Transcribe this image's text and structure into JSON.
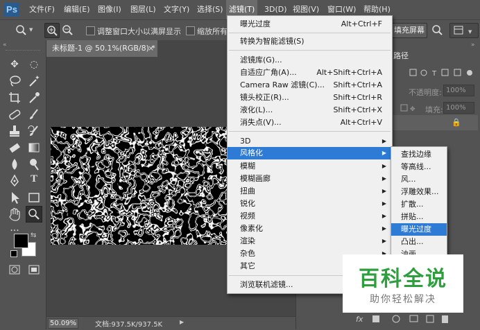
{
  "app": {
    "logo": "Ps"
  },
  "menubar": [
    {
      "label": "文件(F)"
    },
    {
      "label": "编辑(E)"
    },
    {
      "label": "图像(I)"
    },
    {
      "label": "图层(L)"
    },
    {
      "label": "文字(Y)"
    },
    {
      "label": "选择(S)"
    },
    {
      "label": "滤镜(T)"
    },
    {
      "label": "3D(D)"
    },
    {
      "label": "视图(V)"
    },
    {
      "label": "窗口(W)"
    },
    {
      "label": "帮助(H)"
    }
  ],
  "options": {
    "resize_windows": "调整窗口大小以满屏显示",
    "zoom_all": "缩放所有",
    "fill_screen": "填充屏幕"
  },
  "document": {
    "tab_title": "未标题-1 @ 50.1%(RGB/8) *",
    "zoom": "50.09%",
    "doc_info": "文档:937.5K/937.5K"
  },
  "filter_menu": {
    "items": [
      {
        "label": "曝光过度",
        "shortcut": "Alt+Ctrl+F"
      },
      {
        "label": "转换为智能滤镜(S)",
        "shortcut": ""
      },
      {
        "label": "滤镜库(G)...",
        "shortcut": ""
      },
      {
        "label": "自适应广角(A)...",
        "shortcut": "Alt+Shift+Ctrl+A"
      },
      {
        "label": "Camera Raw 滤镜(C)...",
        "shortcut": "Shift+Ctrl+A"
      },
      {
        "label": "镜头校正(R)...",
        "shortcut": "Shift+Ctrl+R"
      },
      {
        "label": "液化(L)...",
        "shortcut": "Shift+Ctrl+X"
      },
      {
        "label": "消失点(V)...",
        "shortcut": "Alt+Ctrl+V"
      },
      {
        "label": "3D",
        "shortcut": ""
      },
      {
        "label": "风格化",
        "shortcut": ""
      },
      {
        "label": "模糊",
        "shortcut": ""
      },
      {
        "label": "模糊画廊",
        "shortcut": ""
      },
      {
        "label": "扭曲",
        "shortcut": ""
      },
      {
        "label": "锐化",
        "shortcut": ""
      },
      {
        "label": "视频",
        "shortcut": ""
      },
      {
        "label": "像素化",
        "shortcut": ""
      },
      {
        "label": "渲染",
        "shortcut": ""
      },
      {
        "label": "杂色",
        "shortcut": ""
      },
      {
        "label": "其它",
        "shortcut": ""
      },
      {
        "label": "浏览联机滤镜...",
        "shortcut": ""
      }
    ]
  },
  "stylize_submenu": {
    "items": [
      {
        "label": "查找边缘"
      },
      {
        "label": "等高线..."
      },
      {
        "label": "风..."
      },
      {
        "label": "浮雕效果..."
      },
      {
        "label": "扩散..."
      },
      {
        "label": "拼贴..."
      },
      {
        "label": "曝光过度"
      },
      {
        "label": "凸出..."
      },
      {
        "label": "油画..."
      }
    ]
  },
  "panels": {
    "paths_tab": "路径",
    "opacity_label": "不透明度:",
    "opacity_value": "100%",
    "fill_label": "填充:",
    "fill_value": "100%"
  },
  "watermark": {
    "title": "百科全说",
    "subtitle": "助你轻松解决"
  },
  "colors": {
    "highlight": "#2d7bd4",
    "ui_bg": "#535353",
    "menu_bg": "#f0f0f0",
    "watermark_green": "#2e9e3e"
  }
}
